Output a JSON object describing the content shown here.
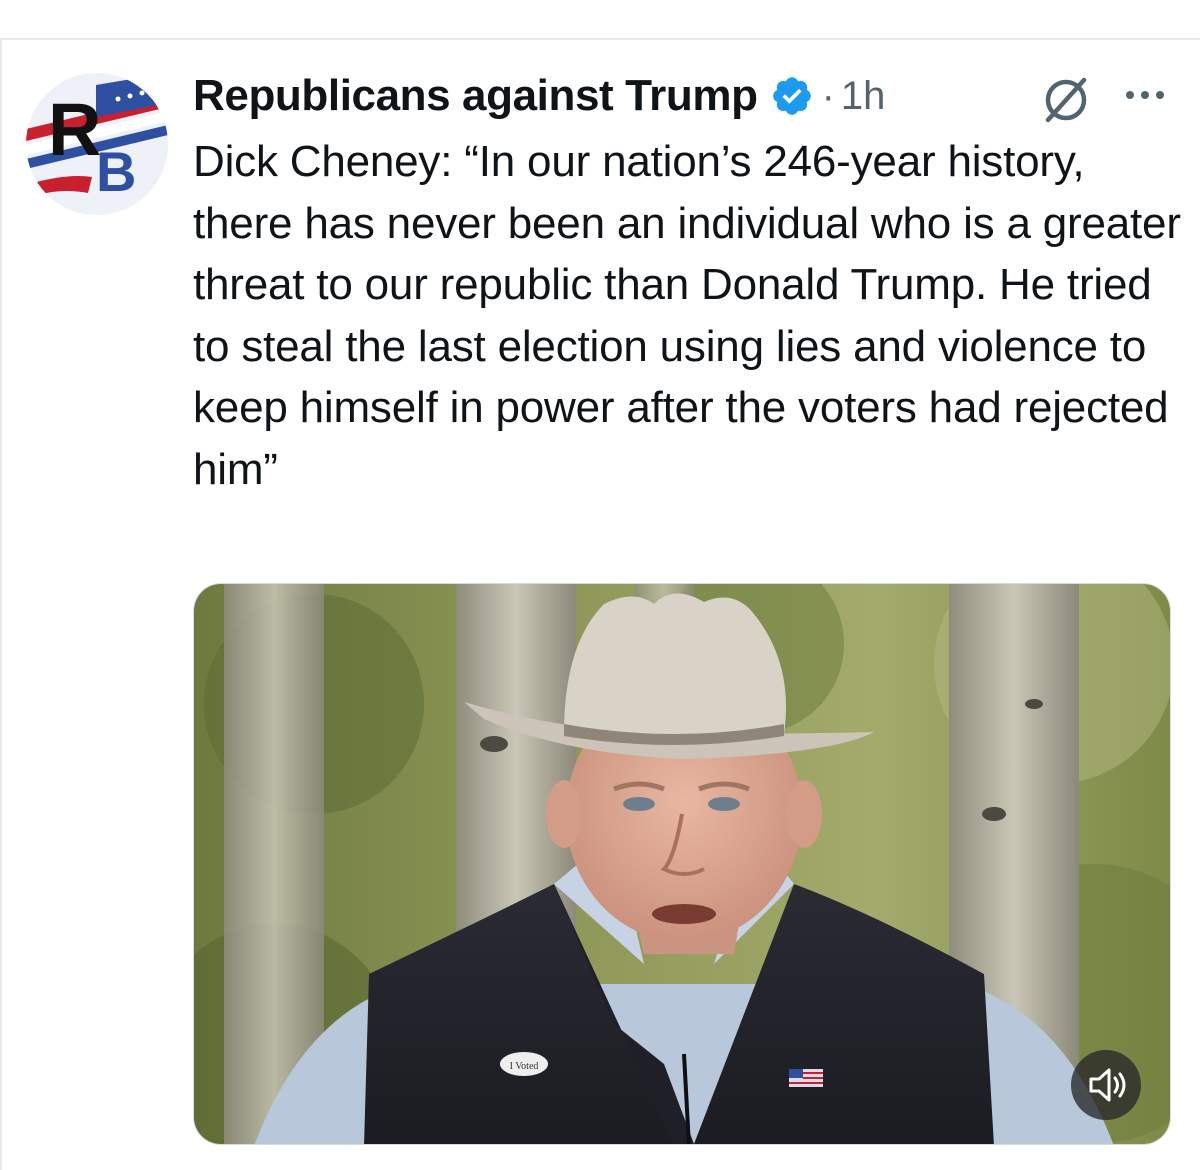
{
  "post": {
    "author": {
      "display_name": "Republicans against Trump",
      "avatar_monogram": "RB",
      "verified_icon": "verified-badge-icon",
      "verified_color": "#1d9bf0"
    },
    "separator": "·",
    "timestamp": "1h",
    "actions": {
      "grok_icon": "grok-icon",
      "more_icon": "more-icon"
    },
    "text": "Dick Cheney: “In our nation’s 246-year history, there has never been an individual who is a greater threat to our republic than Donald Trump. He tried to steal the last election using lies and violence to keep himself in power after the voters had rejected him”",
    "media": {
      "type": "video",
      "sound_icon": "speaker-muted-icon",
      "sticker_text": "I Voted"
    }
  },
  "colors": {
    "text_primary": "#0f1419",
    "text_secondary": "#536471",
    "accent": "#1d9bf0",
    "avatar_red": "#c8202f",
    "avatar_blue": "#2f4fa3"
  }
}
